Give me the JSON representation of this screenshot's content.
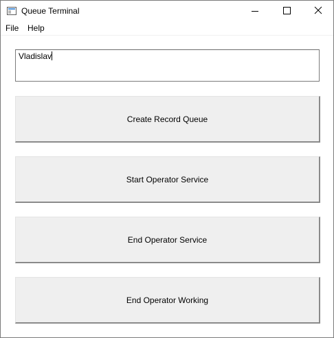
{
  "window": {
    "title": "Queue Terminal",
    "icon": "window-app-icon",
    "controls": [
      "minimize-icon",
      "maximize-icon",
      "close-icon"
    ]
  },
  "menu": {
    "file": "File",
    "help": "Help"
  },
  "name_input": {
    "value": "Vladislav"
  },
  "buttons": {
    "create_record_queue": "Create Record Queue",
    "start_operator_service": "Start Operator Service",
    "end_operator_service": "End Operator Service",
    "end_operator_working": "End Operator Working"
  }
}
